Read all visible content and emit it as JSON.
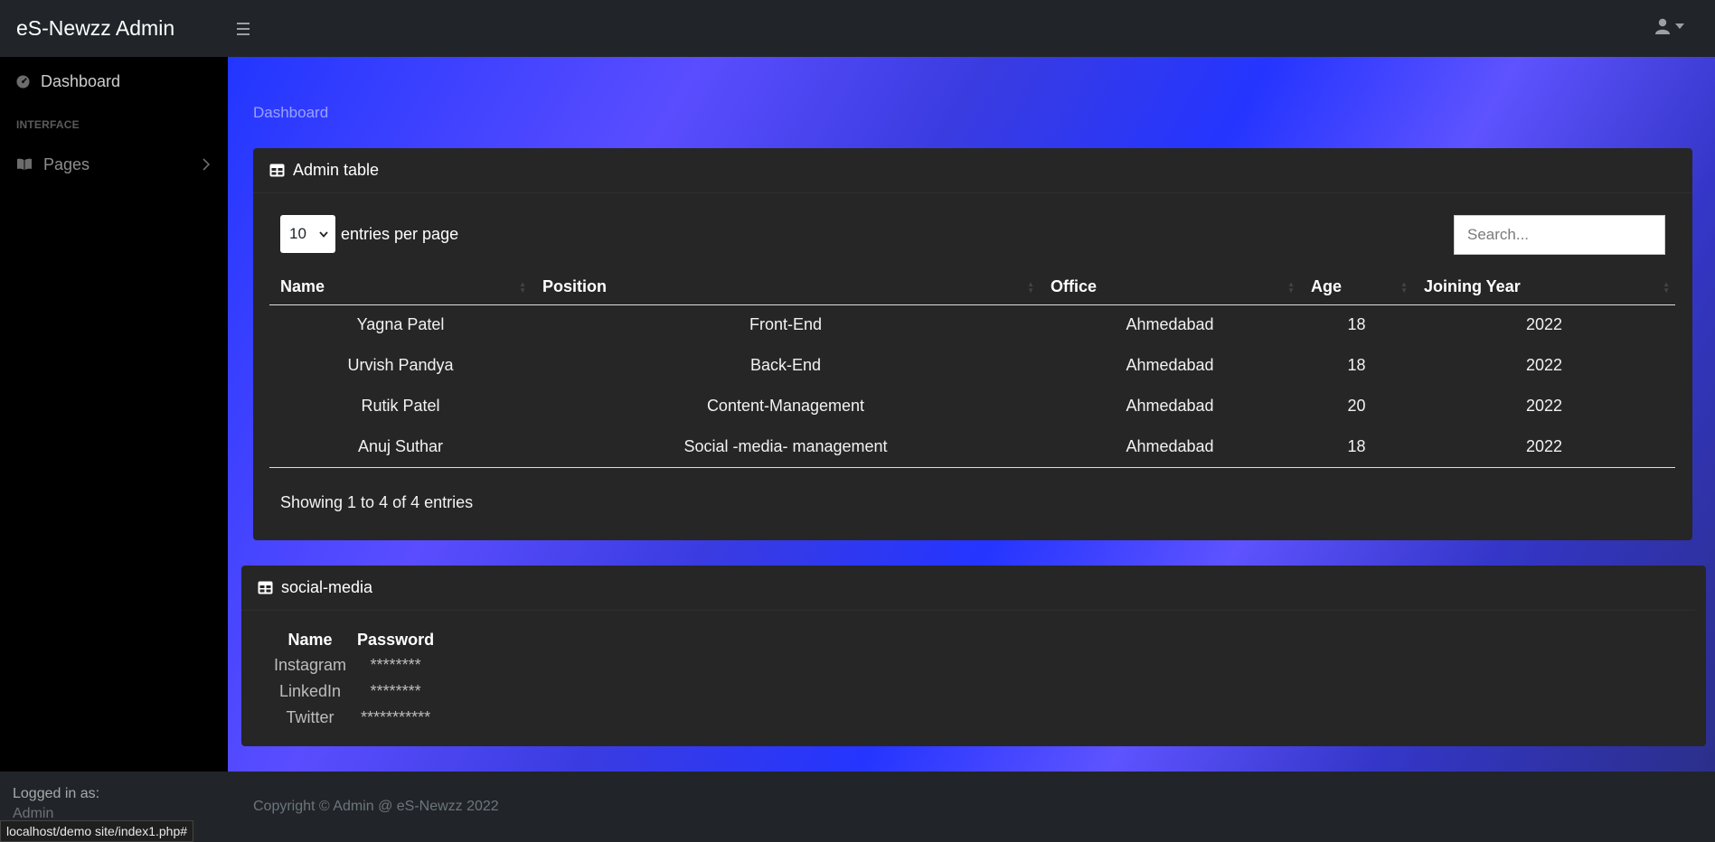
{
  "topnav": {
    "brand": "eS-Newzz Admin"
  },
  "sidebar": {
    "dashboard": "Dashboard",
    "heading": "INTERFACE",
    "pages": "Pages",
    "footer_label": "Logged in as:",
    "footer_user": "Admin"
  },
  "status_url": "localhost/demo site/index1.php#",
  "main": {
    "breadcrumb": "Dashboard",
    "admin_card": {
      "title": "Admin table",
      "per_page_value": "10",
      "per_page_label": "entries per page",
      "search_placeholder": "Search...",
      "columns": [
        "Name",
        "Position",
        "Office",
        "Age",
        "Joining Year"
      ],
      "rows": [
        [
          "Yagna Patel",
          "Front-End",
          "Ahmedabad",
          "18",
          "2022"
        ],
        [
          "Urvish Pandya",
          "Back-End",
          "Ahmedabad",
          "18",
          "2022"
        ],
        [
          "Rutik Patel",
          "Content-Management",
          "Ahmedabad",
          "20",
          "2022"
        ],
        [
          "Anuj Suthar",
          "Social -media- management",
          "Ahmedabad",
          "18",
          "2022"
        ]
      ],
      "info": "Showing 1 to 4 of 4 entries"
    },
    "social_card": {
      "title": "social-media",
      "columns": [
        "Name",
        "Password"
      ],
      "rows": [
        [
          "Instagram",
          "********"
        ],
        [
          "LinkedIn",
          "********"
        ],
        [
          "Twitter",
          "***********"
        ]
      ]
    }
  },
  "footer": {
    "copyright": "Copyright © Admin @ eS-Newzz 2022"
  }
}
